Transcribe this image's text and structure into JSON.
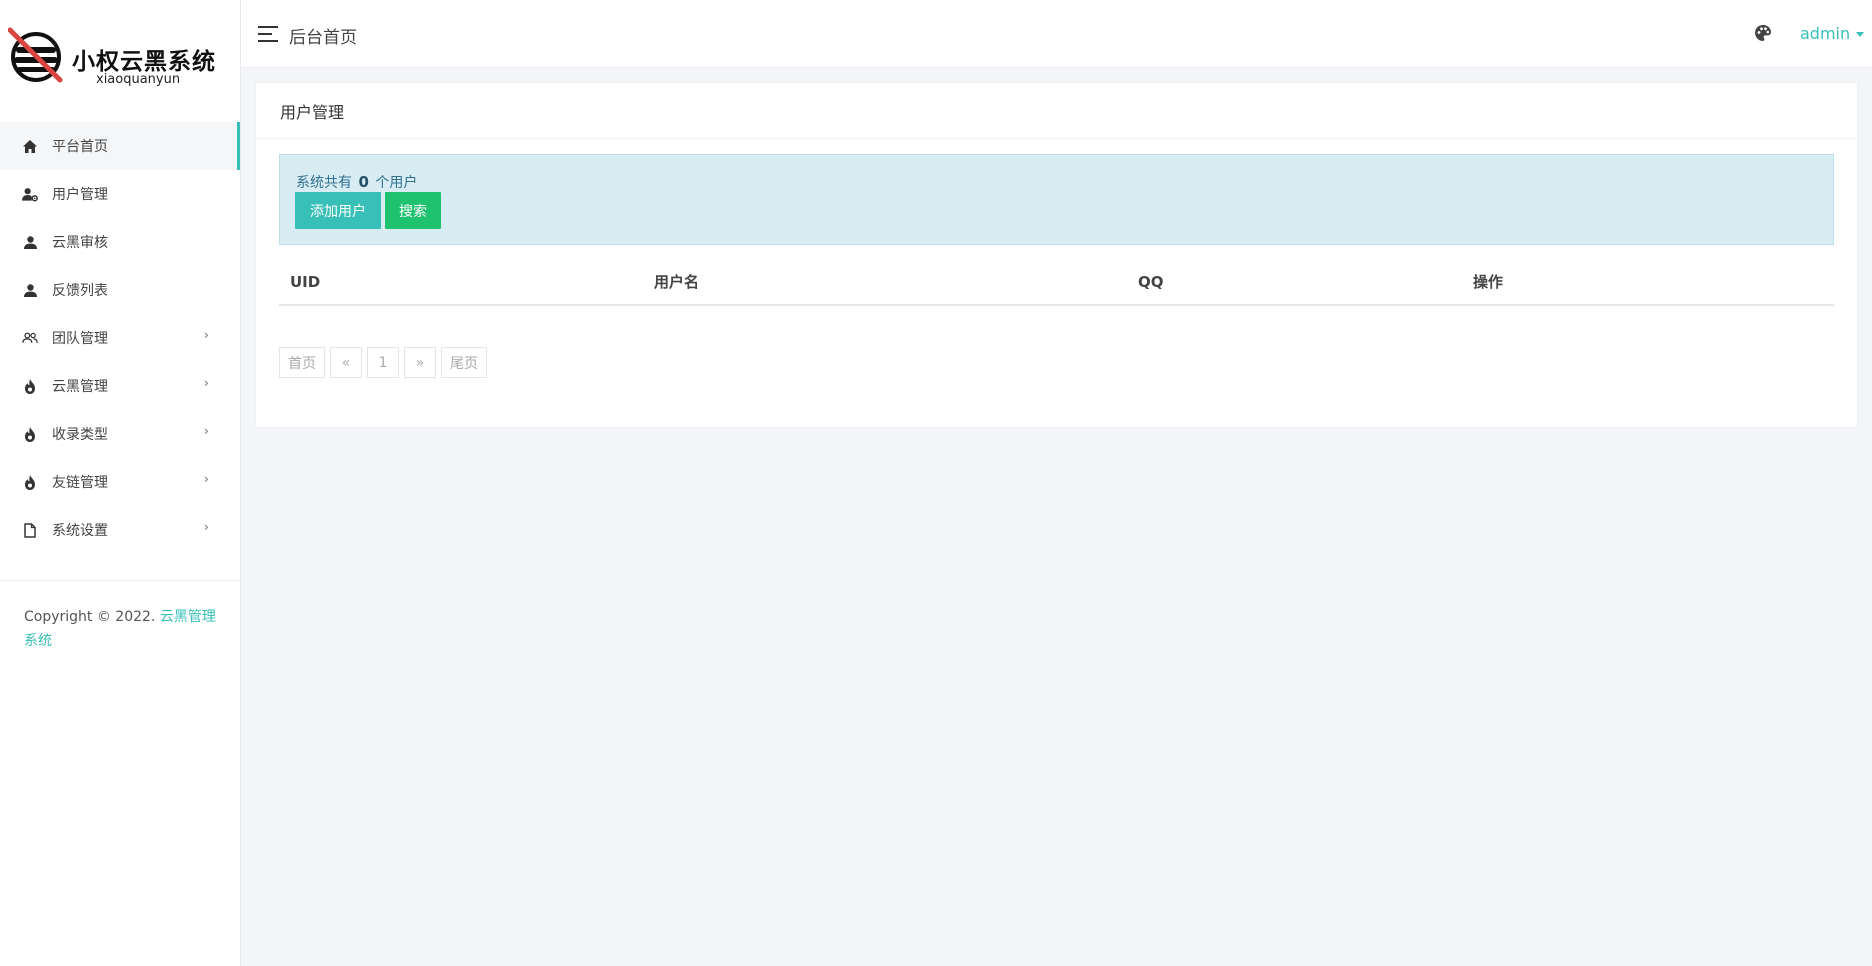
{
  "brand": {
    "title": "小权云黑系统",
    "subtitle": "xiaoquanyun"
  },
  "sidebar": {
    "items": [
      {
        "label": "平台首页",
        "icon": "home-icon",
        "active": true,
        "has_children": false
      },
      {
        "label": "用户管理",
        "icon": "user-gear-icon",
        "active": false,
        "has_children": false
      },
      {
        "label": "云黑审核",
        "icon": "user-icon",
        "active": false,
        "has_children": false
      },
      {
        "label": "反馈列表",
        "icon": "user-icon",
        "active": false,
        "has_children": false
      },
      {
        "label": "团队管理",
        "icon": "users-icon",
        "active": false,
        "has_children": true
      },
      {
        "label": "云黑管理",
        "icon": "fire-icon",
        "active": false,
        "has_children": true
      },
      {
        "label": "收录类型",
        "icon": "fire-icon",
        "active": false,
        "has_children": true
      },
      {
        "label": "友链管理",
        "icon": "fire-icon",
        "active": false,
        "has_children": true
      },
      {
        "label": "系统设置",
        "icon": "file-icon",
        "active": false,
        "has_children": true
      }
    ],
    "chevron": "›",
    "copyright_prefix": "Copyright © 2022. ",
    "copyright_link": "云黑管理系统"
  },
  "topbar": {
    "title": "后台首页",
    "user": "admin"
  },
  "card": {
    "title": "用户管理",
    "alert_prefix": "系统共有",
    "user_count": "0",
    "alert_suffix": "个用户",
    "add_button": "添加用户",
    "search_button": "搜索"
  },
  "table": {
    "columns": [
      "UID",
      "用户名",
      "QQ",
      "操作"
    ],
    "rows": []
  },
  "pagination": {
    "first": "首页",
    "prev": "«",
    "current": "1",
    "next": "»",
    "last": "尾页"
  },
  "colors": {
    "accent": "#38c0b8",
    "search_button": "#1fc26f",
    "alert_bg": "#d8ecf3"
  }
}
